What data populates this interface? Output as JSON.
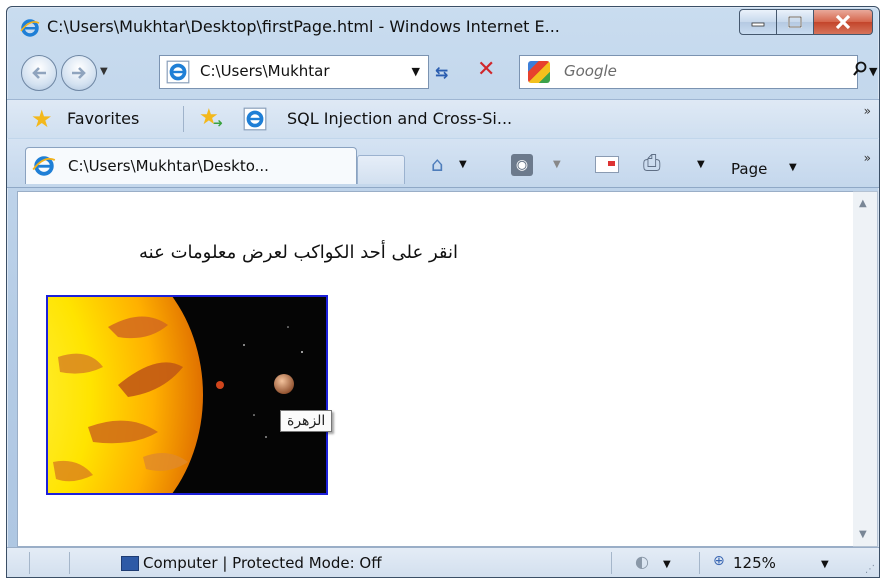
{
  "window": {
    "title": "C:\\Users\\Mukhtar\\Desktop\\firstPage.html - Windows Internet E..."
  },
  "address": {
    "value": "C:\\Users\\Mukhtar"
  },
  "search": {
    "provider_name": "Google",
    "placeholder": "Google"
  },
  "favorites": {
    "label": "Favorites",
    "link": "SQL Injection and Cross-Si..."
  },
  "tab": {
    "label": "C:\\Users\\Mukhtar\\Deskto..."
  },
  "commandbar": {
    "page_label": "Page"
  },
  "page": {
    "instruction": "انقر على أحد الكواكب لعرض معلومات عنه",
    "tooltip": "الزهرة"
  },
  "statusbar": {
    "zone": "Computer | Protected Mode: Off",
    "zoom": "125%"
  },
  "icons": {
    "browser": "ie-icon",
    "back": "back-arrow-icon",
    "forward": "forward-arrow-icon",
    "refresh": "refresh-icon",
    "stop": "stop-icon",
    "search": "search-icon",
    "favorites": "star-icon",
    "add_favorite": "add-favorite-icon",
    "home": "home-icon",
    "feeds": "rss-icon",
    "mail": "mail-icon",
    "print": "print-icon",
    "computer": "computer-icon",
    "globe": "globe-icon",
    "zoom": "zoom-icon"
  },
  "colors": {
    "image_border": "#1c20d9",
    "close_button": "#c3452b",
    "chrome": "#c9dcef"
  }
}
